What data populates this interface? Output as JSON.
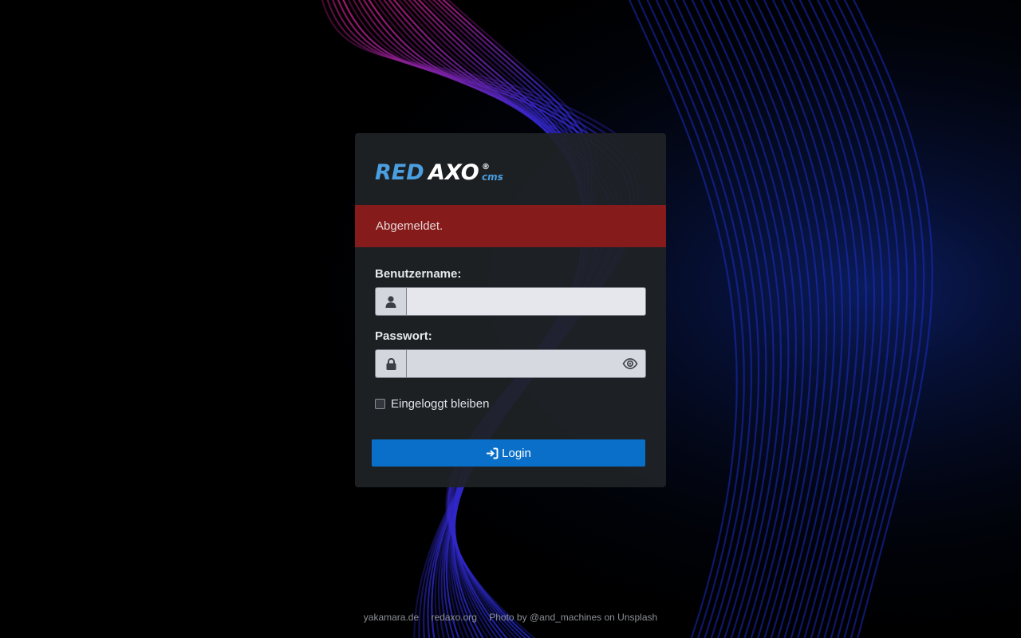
{
  "brand": {
    "logo_text_red": "RED",
    "logo_text_axo": "AXO",
    "logo_registered": "®",
    "logo_cms": "cms"
  },
  "alert": {
    "message": "Abgemeldet."
  },
  "form": {
    "username_label": "Benutzername:",
    "username_value": "",
    "password_label": "Passwort:",
    "password_value": "",
    "remember_label": "Eingeloggt bleiben",
    "remember_checked": false,
    "login_button": "Login"
  },
  "icons": {
    "username": "user-icon",
    "password": "lock-icon",
    "toggle_password": "eye-icon",
    "login": "sign-in-icon"
  },
  "footer": {
    "links": [
      "yakamara.de",
      "redaxo.org"
    ],
    "photo_credit": "Photo by @and_machines on Unsplash"
  },
  "colors": {
    "alert_bg": "#861b1b",
    "button_bg": "#0a6fc8",
    "logo_blue": "#4a9fe0",
    "panel_bg": "#1f2226"
  }
}
